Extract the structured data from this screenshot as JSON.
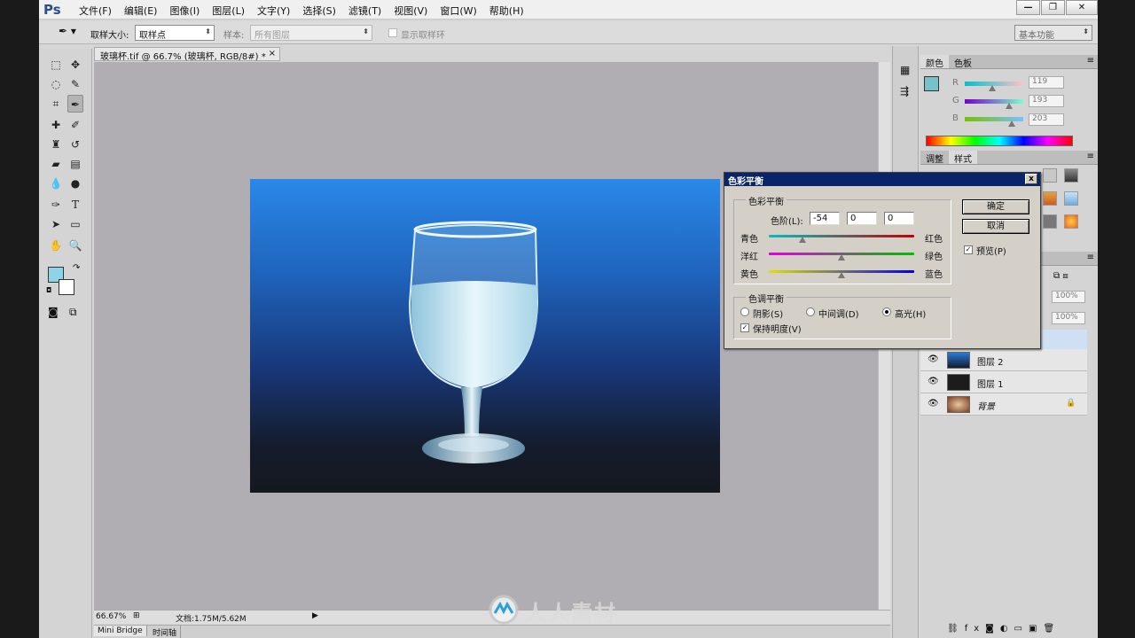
{
  "app": {
    "logo": "Ps"
  },
  "menu": [
    "文件(F)",
    "编辑(E)",
    "图像(I)",
    "图层(L)",
    "文字(Y)",
    "选择(S)",
    "滤镜(T)",
    "视图(V)",
    "窗口(W)",
    "帮助(H)"
  ],
  "window_controls": {
    "minimize": "—",
    "restore": "❐",
    "close": "✕"
  },
  "options": {
    "sample_size_label": "取样大小:",
    "sample_size_value": "取样点",
    "sample_label": "样本:",
    "sample_value": "所有图层",
    "show_ring_label": "显示取样环",
    "workspace": "基本功能"
  },
  "document": {
    "tab_title": "玻璃杯.tif @ 66.7% (玻璃杯, RGB/8#) *",
    "zoom": "66.67%",
    "doc_size": "文档:1.75M/5.62M"
  },
  "bottom_tabs": [
    "Mini Bridge",
    "时间轴"
  ],
  "color_panel": {
    "tabs": [
      "颜色",
      "色板"
    ],
    "r_label": "R",
    "g_label": "G",
    "b_label": "B",
    "r": "119",
    "g": "193",
    "b": "203",
    "r_pos": 0.47,
    "g_pos": 0.76,
    "b_pos": 0.8
  },
  "adjust_panel": {
    "tabs": [
      "调整",
      "样式"
    ]
  },
  "layers_panel": {
    "opacity": "100%",
    "fill": "100%",
    "layers": [
      {
        "name": "图层 2",
        "visible_icon": "👁"
      },
      {
        "name": "图层 1",
        "visible_icon": "👁"
      },
      {
        "name": "背景",
        "visible_icon": "👁"
      }
    ]
  },
  "dialog": {
    "title": "色彩平衡",
    "group1_label": "色彩平衡",
    "levels_label": "色阶(L):",
    "level1": "-54",
    "level2": "0",
    "level3": "0",
    "sliders": [
      {
        "left": "青色",
        "right": "红色",
        "pos": 0.23
      },
      {
        "left": "洋红",
        "right": "绿色",
        "pos": 0.5
      },
      {
        "left": "黄色",
        "right": "蓝色",
        "pos": 0.5
      }
    ],
    "group2_label": "色调平衡",
    "shadows": "阴影(S)",
    "midtones": "中间调(D)",
    "highlights": "高光(H)",
    "preserve": "保持明度(V)",
    "ok": "确定",
    "cancel": "取消",
    "preview": "预览(P)",
    "check_mark": "✓",
    "close_x": "x"
  },
  "watermark": "人人素材"
}
